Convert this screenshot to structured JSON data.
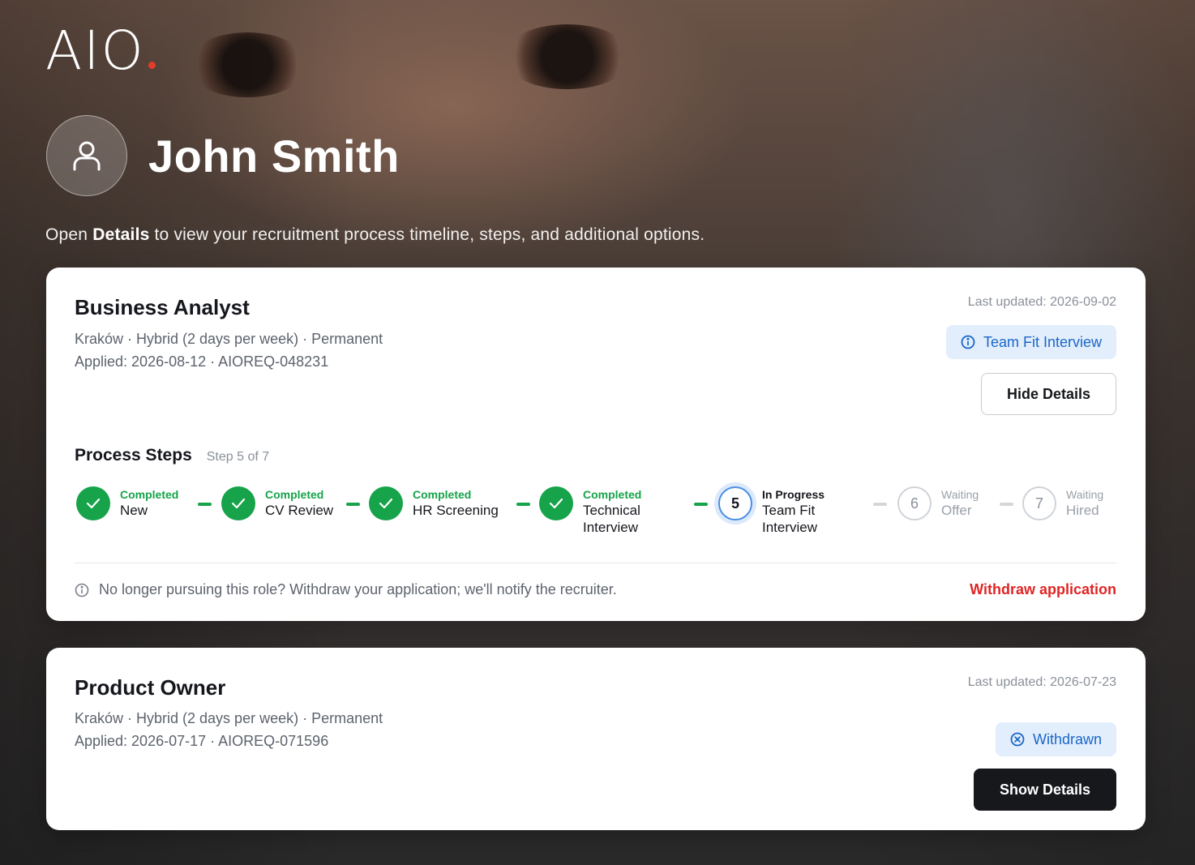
{
  "colors": {
    "accent_red": "#e23c2a",
    "success": "#16a34a",
    "info": "#1a67c8",
    "danger": "#e02424"
  },
  "brand": {
    "logo_text": "AIO",
    "logo_dot_color": "#e23c2a"
  },
  "profile": {
    "name": "John Smith",
    "avatar_icon": "user-icon",
    "hint_prefix": "Open ",
    "hint_bold": "Details",
    "hint_suffix": " to view your recruitment process timeline, steps, and additional options."
  },
  "applications": [
    {
      "title": "Business Analyst",
      "meta_line1": "Kraków · Hybrid (2 days per week) · Permanent",
      "meta_line2": "Applied: 2026-08-12 · AIOREQ-048231",
      "last_updated": "Last updated: 2026-09-02",
      "status_label": "Team Fit Interview",
      "status_icon": "info-icon",
      "details_button": "Hide Details",
      "process": {
        "title": "Process Steps",
        "count": "Step 5 of 7",
        "steps": [
          {
            "status": "Completed",
            "label": "New",
            "state": "done"
          },
          {
            "status": "Completed",
            "label": "CV Review",
            "state": "done"
          },
          {
            "status": "Completed",
            "label": "HR Screening",
            "state": "done"
          },
          {
            "status": "Completed",
            "label_line1": "Technical",
            "label_line2": "Interview",
            "state": "done"
          },
          {
            "number": "5",
            "status": "In Progress",
            "label_line1": "Team Fit",
            "label_line2": "Interview",
            "state": "active"
          },
          {
            "number": "6",
            "status": "Waiting",
            "label": "Offer",
            "state": "wait"
          },
          {
            "number": "7",
            "status": "Waiting",
            "label": "Hired",
            "state": "wait"
          }
        ]
      },
      "withdraw_note": "No longer pursuing this role? Withdraw your application; we'll notify the recruiter.",
      "withdraw_link": "Withdraw application"
    },
    {
      "title": "Product Owner",
      "meta_line1": "Kraków · Hybrid (2 days per week) · Permanent",
      "meta_line2": "Applied: 2026-07-17 · AIOREQ-071596",
      "last_updated": "Last updated: 2026-07-23",
      "status_label": "Withdrawn",
      "status_icon": "circle-x-icon",
      "details_button": "Show Details"
    }
  ]
}
